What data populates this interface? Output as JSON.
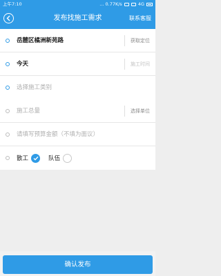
{
  "status_bar": {
    "time": "上午7:10",
    "network_speed": "... 0.77K/s",
    "network_type": "4G",
    "icons": [
      "alarm-icon",
      "wifi-icon",
      "signal-icon",
      "battery-icon"
    ]
  },
  "header": {
    "title": "发布找施工需求",
    "right_action": "联系客服",
    "back_icon": "back-arrow-icon"
  },
  "form": {
    "location": {
      "value": "岳麓区橘洲新苑路",
      "action": "获取定位"
    },
    "time": {
      "value": "今天",
      "action": "施工时间"
    },
    "category": {
      "placeholder": "选择施工类别"
    },
    "total": {
      "placeholder": "施工总量",
      "action": "选择单位"
    },
    "budget": {
      "placeholder": "请填写预算金额（不填为面议）"
    },
    "worker_type": {
      "options": [
        {
          "label": "散工",
          "checked": true
        },
        {
          "label": "队伍",
          "checked": false
        }
      ]
    }
  },
  "footer": {
    "confirm_label": "确认发布"
  },
  "colors": {
    "primary": "#2f9be6",
    "background": "#eeeeee",
    "text": "#222222",
    "placeholder": "#b0b0b0"
  }
}
